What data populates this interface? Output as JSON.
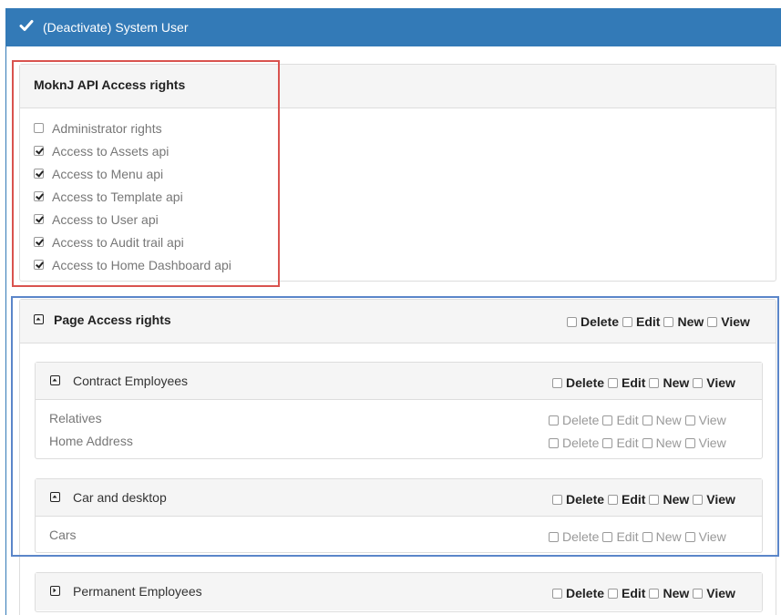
{
  "header": {
    "title": "(Deactivate) System User",
    "icon": "check-icon",
    "color": "#337ab7"
  },
  "api_rights": {
    "title": "MoknJ API Access rights",
    "items": [
      {
        "label": "Administrator rights",
        "checked": false
      },
      {
        "label": "Access to Assets api",
        "checked": true
      },
      {
        "label": "Access to Menu api",
        "checked": true
      },
      {
        "label": "Access to Template api",
        "checked": true
      },
      {
        "label": "Access to User api",
        "checked": true
      },
      {
        "label": "Access to Audit trail api",
        "checked": true
      },
      {
        "label": "Access to Home Dashboard api",
        "checked": true
      }
    ]
  },
  "permission_labels": {
    "delete": "Delete",
    "edit": "Edit",
    "new": "New",
    "view": "View"
  },
  "page_rights": {
    "title": "Page Access rights",
    "sections": [
      {
        "title": "Contract Employees",
        "expanded": true,
        "rows": [
          "Relatives",
          "Home Address"
        ]
      },
      {
        "title": "Car and desktop",
        "expanded": true,
        "rows": [
          "Cars"
        ]
      },
      {
        "title": "Permanent Employees",
        "expanded": false,
        "rows": []
      }
    ]
  },
  "highlight_colors": {
    "red": "#d9534f",
    "blue": "#5b86c9"
  }
}
